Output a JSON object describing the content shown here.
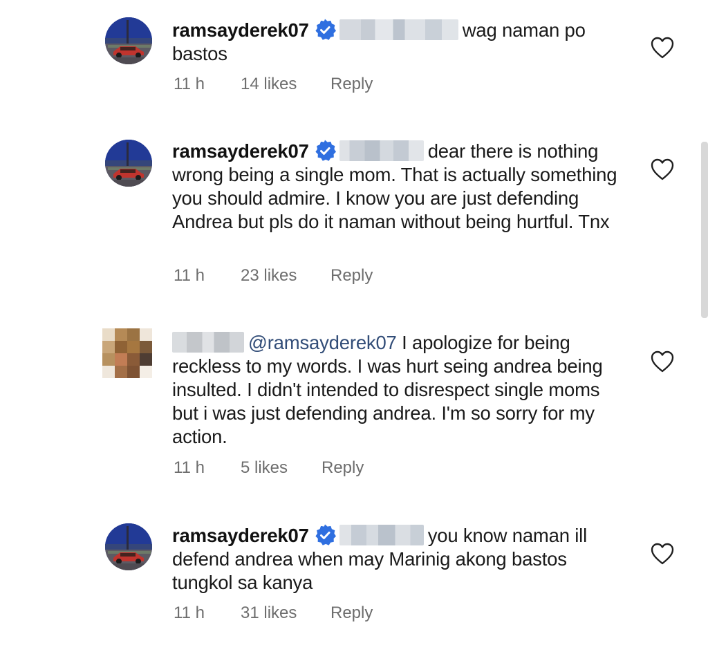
{
  "comments": [
    {
      "username": "ramsayderek07",
      "verified": true,
      "text": "wag naman po bastos",
      "time": "11 h",
      "likes": "14 likes",
      "reply_label": "Reply"
    },
    {
      "username": "ramsayderek07",
      "verified": true,
      "text": "dear there is nothing wrong being a single mom. That is actually something you should admire. I know you are just defending Andrea but pls do it naman without being hurtful. Tnx",
      "time": "11 h",
      "likes": "23 likes",
      "reply_label": "Reply"
    },
    {
      "username": "",
      "verified": false,
      "mention": "@ramsayderek07",
      "text": "I apologize for being reckless to my words. I was hurt seing andrea being insulted. I didn't intended to disrespect single moms but i was just defending  andrea. I'm so sorry for my action.",
      "time": "11 h",
      "likes": "5 likes",
      "reply_label": "Reply"
    },
    {
      "username": "ramsayderek07",
      "verified": true,
      "text": "you know naman ill defend andrea when may Marinig akong bastos tungkol sa kanya",
      "time": "11 h",
      "likes": "31 likes",
      "reply_label": "Reply"
    }
  ],
  "icons": {
    "like": "heart-outline-icon",
    "verified": "verified-badge-icon"
  },
  "colors": {
    "verified_blue": "#2f6fe0",
    "mention": "#324d78",
    "meta_gray": "#6d6d6d"
  }
}
